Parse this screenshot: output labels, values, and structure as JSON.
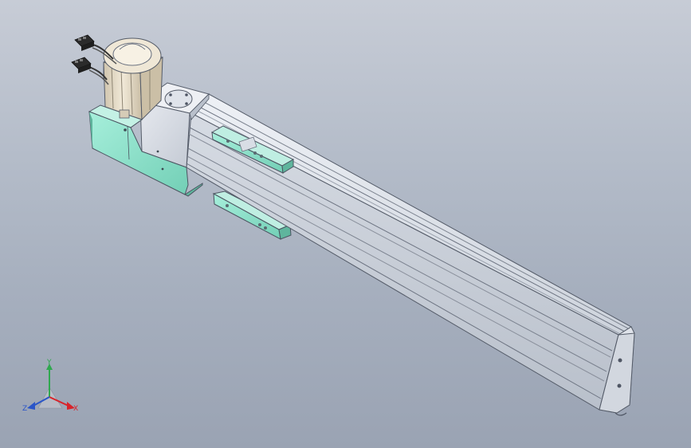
{
  "triad": {
    "x_label": "X",
    "y_label": "Y",
    "z_label": "Z"
  },
  "colors": {
    "background_top": "#c7ccd6",
    "background_bottom": "#9aa3b3",
    "rail_body": "#c9cfd8",
    "rail_edge": "#5b6270",
    "mount_bracket": "#8fe3cc",
    "motor_body": "#e4dac7",
    "axis_x": "#d8232a",
    "axis_y": "#2fa84f",
    "axis_z": "#2a55c8"
  }
}
